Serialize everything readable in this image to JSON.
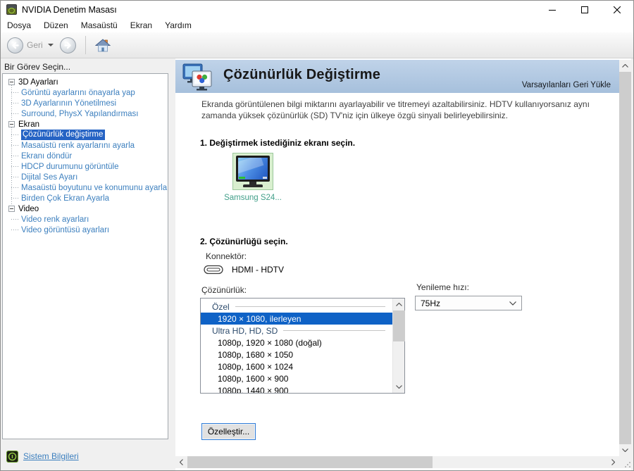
{
  "window": {
    "title": "NVIDIA Denetim Masası"
  },
  "menu": {
    "items": [
      "Dosya",
      "Düzen",
      "Masaüstü",
      "Ekran",
      "Yardım"
    ]
  },
  "toolbar": {
    "back_label": "Geri"
  },
  "sidebar": {
    "header": "Bir Görev Seçin...",
    "groups": [
      {
        "label": "3D Ayarları",
        "children": [
          "Görüntü ayarlarını önayarla yap",
          "3D Ayarlarının Yönetilmesi",
          "Surround, PhysX Yapılandırması"
        ]
      },
      {
        "label": "Ekran",
        "selected_child": "Çözünürlük değiştirme",
        "children": [
          "Çözünürlük değiştirme",
          "Masaüstü renk ayarlarını ayarla",
          "Ekranı döndür",
          "HDCP durumunu görüntüle",
          "Dijital Ses Ayarı",
          "Masaüstü boyutunu ve konumunu ayarla",
          "Birden Çok Ekran Ayarla"
        ]
      },
      {
        "label": "Video",
        "children": [
          "Video renk ayarları",
          "Video görüntüsü ayarları"
        ]
      }
    ],
    "footer_link": "Sistem Bilgileri"
  },
  "content": {
    "title": "Çözünürlük Değiştirme",
    "restore_defaults": "Varsayılanları Geri Yükle",
    "description": "Ekranda görüntülenen bilgi miktarını ayarlayabilir ve titremeyi azaltabilirsiniz. HDTV kullanıyorsanız aynı zamanda yüksek çözünürlük (SD) TV'niz için ülkeye özgü sinyali belirleyebilirsiniz.",
    "step1": {
      "title": "1. Değiştirmek istediğiniz ekranı seçin.",
      "display_name": "Samsung S24..."
    },
    "step2": {
      "title": "2. Çözünürlüğü seçin.",
      "connector_label": "Konnektör:",
      "connector_value": "HDMI - HDTV",
      "resolution_label": "Çözünürlük:",
      "refresh_label": "Yenileme hızı:",
      "refresh_value": "75Hz",
      "resolution_list": [
        {
          "kind": "group",
          "label": "Özel"
        },
        {
          "kind": "item",
          "label": "1920 × 1080, ilerleyen",
          "selected": true
        },
        {
          "kind": "group",
          "label": "Ultra HD, HD, SD"
        },
        {
          "kind": "item",
          "label": "1080p, 1920 × 1080 (doğal)"
        },
        {
          "kind": "item",
          "label": "1080p, 1680 × 1050"
        },
        {
          "kind": "item",
          "label": "1080p, 1600 × 1024"
        },
        {
          "kind": "item",
          "label": "1080p, 1600 × 900"
        },
        {
          "kind": "item",
          "label": "1080p, 1440 × 900",
          "partially_visible": true
        }
      ]
    },
    "customize_button": "Özelleştir..."
  },
  "colors": {
    "selection_blue": "#0f62c6",
    "tree_link_blue": "#3c7fbe",
    "banner_blue_top": "#c0d3e9",
    "banner_blue_bottom": "#a6c0dc",
    "display_label_teal": "#43a08a",
    "selected_tile_green": "#d9efcf"
  }
}
